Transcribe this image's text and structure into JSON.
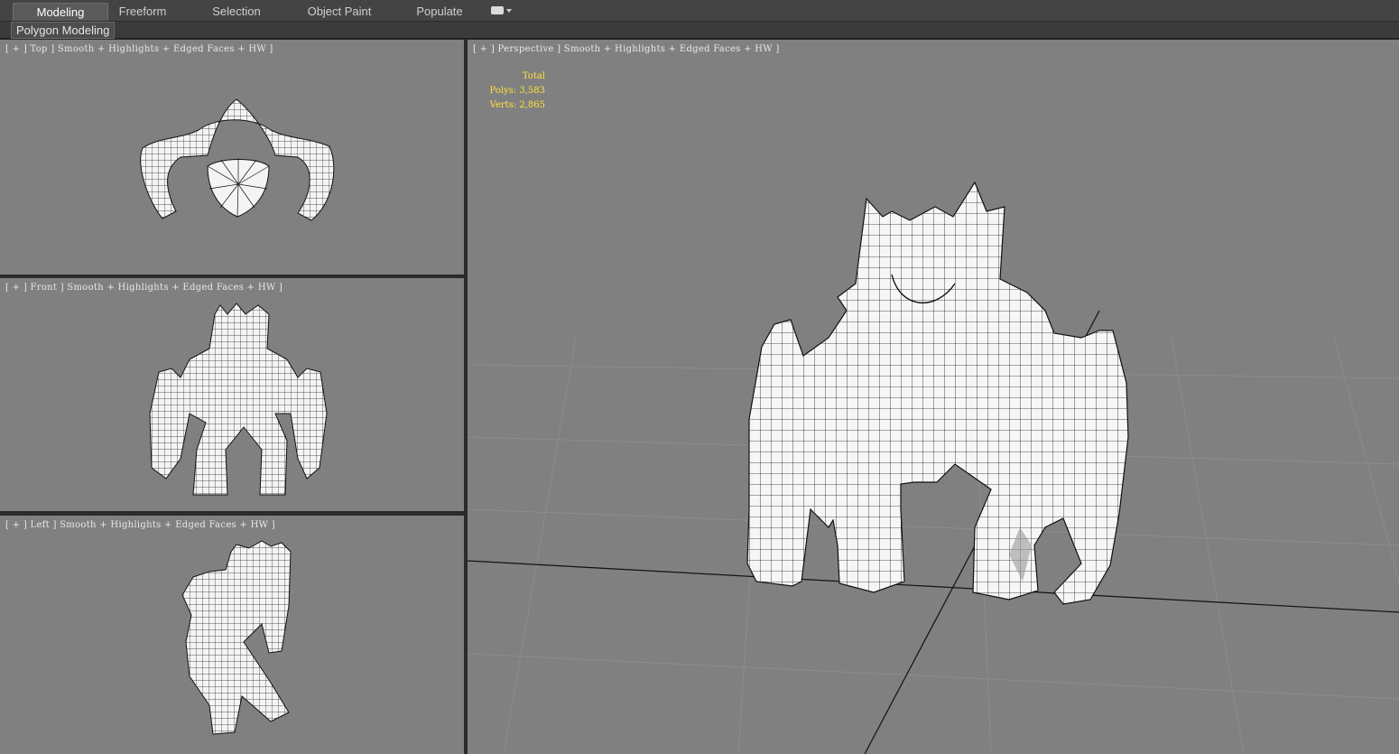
{
  "ribbon": {
    "tabs": [
      {
        "label": "Modeling",
        "active": true
      },
      {
        "label": "Freeform",
        "active": false
      },
      {
        "label": "Selection",
        "active": false
      },
      {
        "label": "Object Paint",
        "active": false
      },
      {
        "label": "Populate",
        "active": false
      }
    ],
    "extra_icon": "dropdown-icon",
    "subpanel": "Polygon Modeling"
  },
  "viewports": {
    "top": {
      "label": "[ + ] Top ] Smooth + Highlights + Edged Faces + HW ]"
    },
    "front": {
      "label": "[ + ] Front ] Smooth + Highlights + Edged Faces + HW ]"
    },
    "left": {
      "label": "[ + ] Left ] Smooth + Highlights + Edged Faces + HW ]"
    },
    "perspective": {
      "label": "[ + ] Perspective ] Smooth + Highlights + Edged Faces + HW ]"
    }
  },
  "stats": {
    "header": "Total",
    "polys": "Polys: 3,583",
    "verts": "Verts: 2,865"
  },
  "colors": {
    "viewport_bg": "#808080",
    "stats_text": "#ffe23b",
    "active_tab": "#5a5a5a"
  }
}
